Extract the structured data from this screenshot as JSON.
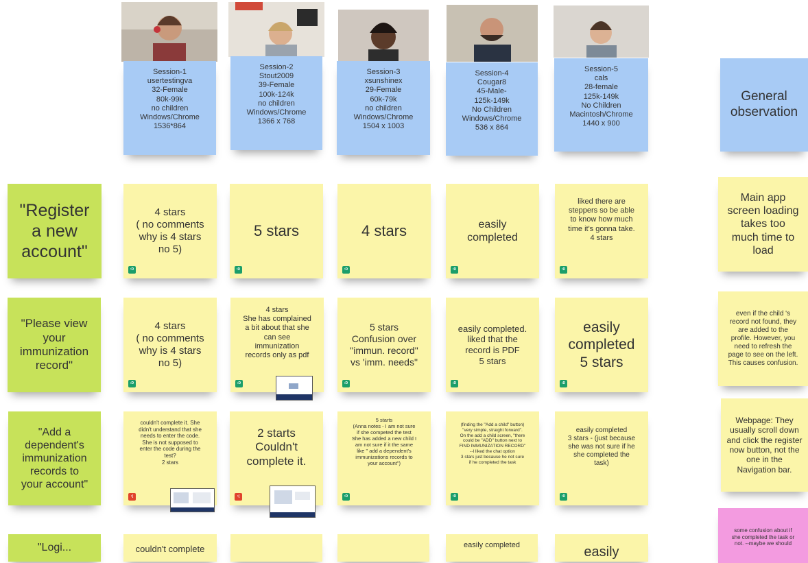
{
  "colors": {
    "session_note": "#a8cbf5",
    "feedback_note": "#fbf5a9",
    "task_note": "#c7e25a",
    "issue_note": "#f39be0",
    "badge_success": "#1b9e6a",
    "badge_fail": "#e0432b"
  },
  "sessions": [
    {
      "text": "Session-1\nusertestingva\n32-Female\n80k-99k\nno children\nWindows/Chrome\n1536*864"
    },
    {
      "text": "Session-2\nStout2009\n39-Female\n100k-124k\nno children\nWindows/Chrome\n1366 x 768"
    },
    {
      "text": "Session-3\nxsunshinex\n29-Female\n60k-79k\nno children\nWindows/Chrome\n1504 x 1003"
    },
    {
      "text": "Session-4\nCougar8\n45-Male-\n125k-149k\nNo Children\nWindows/Chrome\n536 x 864"
    },
    {
      "text": "Session-5\ncals\n28-female\n125k-149k\nNo Children\nMacintosh/Chrome\n1440 x 900"
    }
  ],
  "general": {
    "title": "General observation"
  },
  "tasks": [
    {
      "text": "\"Register\na new\naccount\""
    },
    {
      "text": "\"Please view\nyour\nimmunization\nrecord\""
    },
    {
      "text": "\"Add a\ndependent's\nimmunization\nrecords to\nyour account\""
    },
    {
      "text": "\"Logi..."
    }
  ],
  "badges": {
    "success": ":D",
    "fail": ":("
  },
  "row1": [
    {
      "text": "4 stars\n( no comments\nwhy is 4 stars\nno 5)"
    },
    {
      "text": "5 stars"
    },
    {
      "text": "4 stars"
    },
    {
      "text": "easily\ncompleted"
    },
    {
      "text": "liked there are\nsteppers so be able\nto know how much\ntime it's gonna take.\n4 stars"
    }
  ],
  "row2": [
    {
      "text": "4 stars\n( no comments\nwhy is 4 stars\nno 5)"
    },
    {
      "text": "4 stars\nShe has complained\na bit about that she\ncan see\nimmunization\nrecords only as pdf"
    },
    {
      "text": "5 stars\nConfusion over\n\"immun. record\"\nvs 'imm. needs\""
    },
    {
      "text": "easily completed.\nliked that the\nrecord is PDF\n5 stars"
    },
    {
      "text": "easily\ncompleted\n5 stars"
    }
  ],
  "row3": [
    {
      "text": "couldn't complete it. She\ndidn't understand that she\nneeds to enter the code.\nShe is not supposed to\nenter the code during the\ntest?\n2 stars"
    },
    {
      "text": "2 starts\nCouldn't\ncomplete it."
    },
    {
      "text": "5 starts\n(Anna notes - I am not sure\nif she competed  the test\nShe has added a new child I\nam not sure if it the same\nlike \" add a dependent's\nimmunizations records to\nyour account\")"
    },
    {
      "text": "(finding the \"Add a child\" button)\n\"very simple, straight forward\".\nOn the add a child screen, \"there\ncould be \"ADD\" button next to\nFIND IMMUNIZATION RECORD\"\n--I liked the chat option\n3 stars just because he not sure\nif he completed the task"
    },
    {
      "text": "easily completed\n3 stars - (just because\nshe was not sure if he\nshe completed the\ntask)"
    }
  ],
  "row4": [
    {
      "text": "couldn't complete"
    },
    {
      "text": ""
    },
    {
      "text": ""
    },
    {
      "text": "easily completed"
    },
    {
      "text": "easily"
    }
  ],
  "observations": [
    {
      "text": "Main app\nscreen loading\ntakes too\nmuch time to\nload"
    },
    {
      "text": "even if the child 's\nrecord not found, they\nare added to the\nprofile. However, you\nneed to refresh the\npage to see  on the left.\nThis causes confusion."
    },
    {
      "text": "Webpage: They\nusually scroll down\nand click the register\nnow button, not the\none in the\nNavigation bar."
    },
    {
      "text": "some confusion about if\nshe completed the task or\nnot. --maybe we should"
    }
  ]
}
